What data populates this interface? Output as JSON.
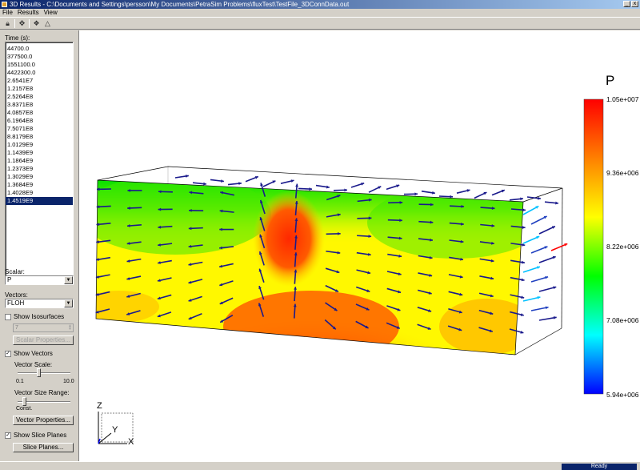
{
  "window": {
    "title": "3D Results - C:\\Documents and Settings\\persson\\My Documents\\PetraSim Problems\\fluxTest\\TestFile_3DConnData.out",
    "minimize": "_",
    "close": "x"
  },
  "menu": {
    "file": "File",
    "results": "Results",
    "view": "View"
  },
  "toolbar": {
    "icons": [
      "lock-icon",
      "move-icon",
      "objects-icon",
      "axes-icon"
    ]
  },
  "left": {
    "time_label": "Time (s):",
    "times": [
      "44700.0",
      "377500.0",
      "1551100.0",
      "4422300.0",
      "2.6541E7",
      "1.2157E8",
      "2.5264E8",
      "3.8371E8",
      "4.0857E8",
      "6.1964E8",
      "7.5071E8",
      "8.8179E8",
      "1.0129E9",
      "1.1439E9",
      "1.1864E9",
      "1.2373E9",
      "1.3029E9",
      "1.3684E9",
      "1.4028E9",
      "1.4519E9"
    ],
    "selected_index": 19,
    "scalar_label": "Scalar:",
    "scalar_value": "P",
    "vectors_label": "Vectors:",
    "vectors_value": "FLOH",
    "show_isosurfaces": "Show Isosurfaces",
    "isosurfaces_checked": false,
    "iso_count": "7",
    "scalar_properties": "Scalar Properties...",
    "show_vectors": "Show Vectors",
    "vectors_checked": true,
    "vector_scale_label": "Vector Scale:",
    "vector_scale": {
      "min": "0.1",
      "max": "10.0",
      "value": 0.4
    },
    "vector_size_range_label": "Vector Size Range:",
    "vector_size_range": {
      "min_label": "Const.",
      "value": 0.1
    },
    "vector_properties": "Vector Properties...",
    "show_slice_planes": "Show Slice Planes",
    "slice_checked": true,
    "slice_planes": "Slice Planes..."
  },
  "legend": {
    "title": "P",
    "ticks": [
      "1.05e+007",
      "9.36e+006",
      "8.22e+006",
      "7.08e+006",
      "5.94e+006"
    ],
    "colors": [
      "#ff0000",
      "#ff8000",
      "#ffff00",
      "#00ff00",
      "#00ffff",
      "#0000ff"
    ]
  },
  "axes": {
    "z": "Z",
    "y": "Y",
    "x": "X"
  },
  "colors": {
    "arrow": "#1a1a8c",
    "box": "#000000"
  },
  "status": {
    "text": "Ready"
  }
}
